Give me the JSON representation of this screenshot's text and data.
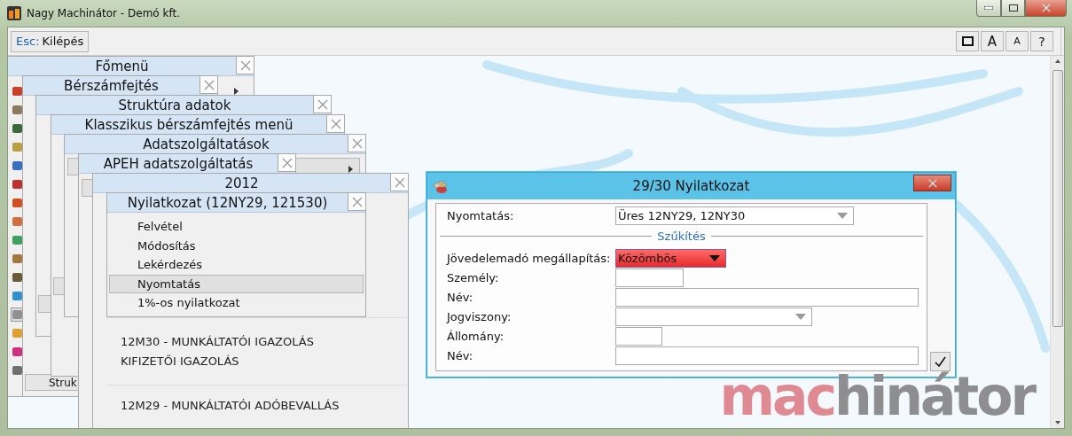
{
  "window": {
    "title": "Nagy Machinátor - Demó kft."
  },
  "toolbar": {
    "exit": {
      "key": "Esc:",
      "label": "Kilépés"
    },
    "buttons": [
      {
        "kind": "frame"
      },
      {
        "kind": "font_large",
        "label": "A"
      },
      {
        "kind": "font_small",
        "label": "A"
      },
      {
        "kind": "text",
        "label": "?"
      }
    ]
  },
  "sidebar_icons": [
    {
      "color": "#c8402a",
      "selected": false
    },
    {
      "color": "#8a7a60",
      "selected": false
    },
    {
      "color": "#3a6a3a",
      "selected": false
    },
    {
      "color": "#b8a040",
      "selected": false
    },
    {
      "color": "#3a70c0",
      "selected": false
    },
    {
      "color": "#c03030",
      "selected": false
    },
    {
      "color": "#d05020",
      "selected": false
    },
    {
      "color": "#d07040",
      "selected": false
    },
    {
      "color": "#40a060",
      "selected": false
    },
    {
      "color": "#a07840",
      "selected": false
    },
    {
      "color": "#6a5a3a",
      "selected": false
    },
    {
      "color": "#3090d0",
      "selected": false
    },
    {
      "color": "#909090",
      "selected": true
    },
    {
      "color": "#e0a030",
      "selected": false
    },
    {
      "color": "#d03080",
      "selected": false
    },
    {
      "color": "#707070",
      "selected": false
    }
  ],
  "menu_panels": [
    {
      "title": "Főmenü"
    },
    {
      "title": "Bérszámfejtés"
    },
    {
      "title": "Struktúra adatok"
    },
    {
      "title": "Klasszikus bérszámfejtés menü"
    },
    {
      "title": "Adatszolgáltatások"
    },
    {
      "title": "APEH adatszolgáltatás"
    },
    {
      "title": "2012"
    },
    {
      "title": "Nyilatkozat (12NY29, 121530)"
    }
  ],
  "cut_button": "Struk",
  "declaration_menu": [
    {
      "label": "Felvétel",
      "selected": false
    },
    {
      "label": "Módosítás",
      "selected": false
    },
    {
      "label": "Lekérdezés",
      "selected": false
    },
    {
      "label": "Nyomtatás",
      "selected": true
    },
    {
      "label": "1%-os nyilatkozat",
      "selected": false
    }
  ],
  "year_rows": [
    {
      "lines": [
        "12M30 - MUNKÁLTATÓI IGAZOLÁS",
        "KIFIZETŐI IGAZOLÁS"
      ]
    },
    {
      "lines": [
        "12M29 - MUNKÁLTATÓI ADÓBEVALLÁS"
      ]
    }
  ],
  "dialog": {
    "title": "29/30 Nyilatkozat",
    "print": {
      "label": "Nyomtatás:",
      "value": "Üres 12NY29, 12NY30"
    },
    "section": "Szűkítés",
    "fields": [
      {
        "kind": "alert_select",
        "label": "Jövedelemadó megállapítás:",
        "value": "Közömbös"
      },
      {
        "kind": "short",
        "label": "Személy:"
      },
      {
        "kind": "wide",
        "label": "Név:"
      },
      {
        "kind": "select",
        "label": "Jogviszony:"
      },
      {
        "kind": "tiny",
        "label": "Állomány:"
      },
      {
        "kind": "wide",
        "label": "Név:"
      }
    ]
  },
  "logo": {
    "accent": "mac",
    "rest": "hinátor"
  }
}
